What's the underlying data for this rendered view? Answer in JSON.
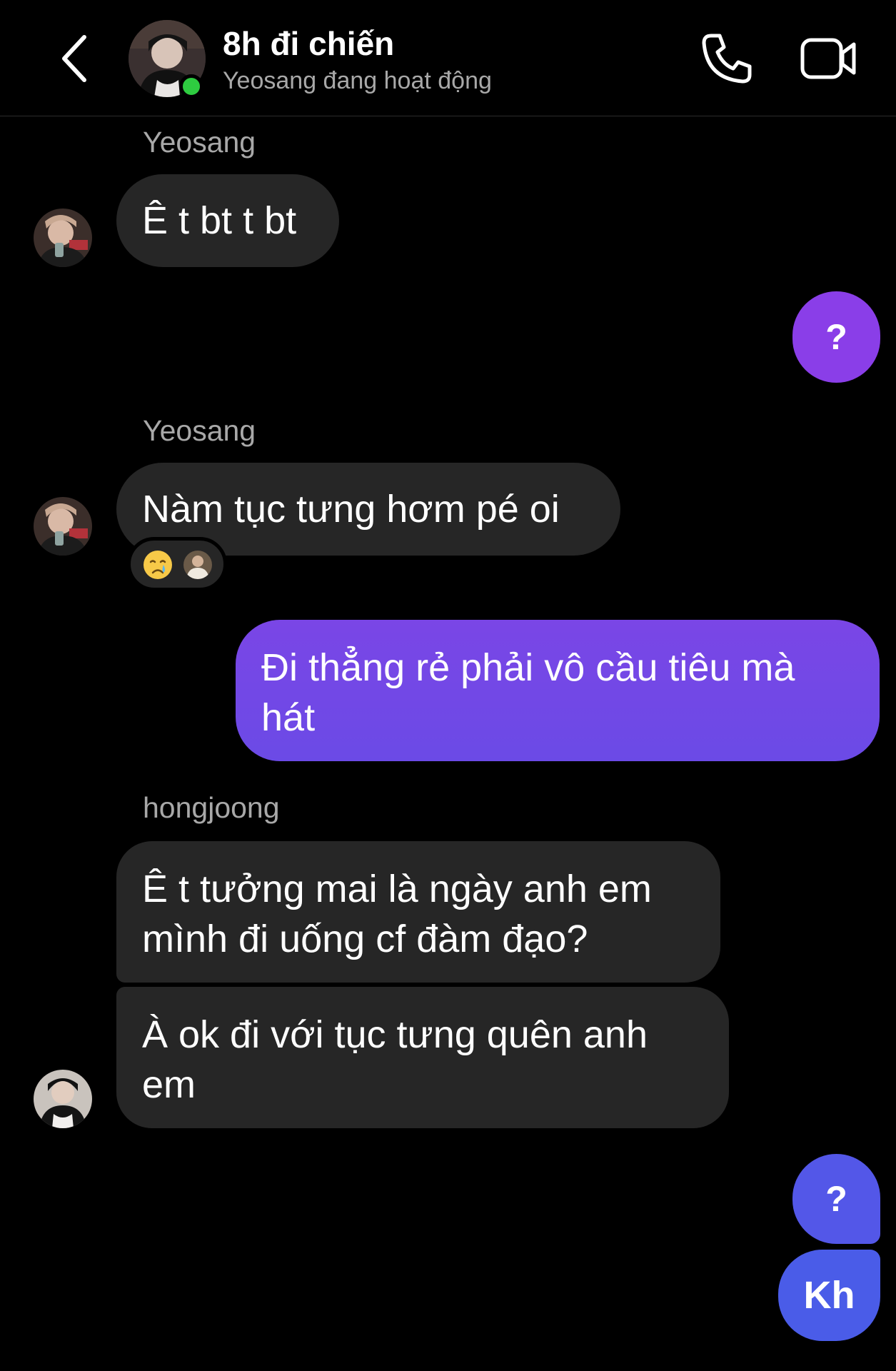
{
  "header": {
    "title": "8h đi chiến",
    "status": "Yeosang đang hoạt động",
    "icons": [
      "back-arrow-icon",
      "phone-icon",
      "video-camera-icon"
    ]
  },
  "colors": {
    "background": "#000000",
    "incoming_bubble": "#262626",
    "outgoing_gradient_top": "#8b3fe6",
    "outgoing_gradient_bottom": "#4a5be8",
    "secondary_text": "#a8a8a8",
    "online": "#2ecc40"
  },
  "messages": [
    {
      "direction": "in",
      "sender": "Yeosang",
      "text": "Ê t bt t bt"
    },
    {
      "direction": "out",
      "text": "?"
    },
    {
      "direction": "in",
      "sender": "Yeosang",
      "text": "Nàm tục tưng hơm pé oi",
      "reaction": "crying-face-emoji"
    },
    {
      "direction": "out",
      "lines": [
        "Đi thẳng rẻ phải vô cầu tiêu mà",
        "hát"
      ]
    },
    {
      "direction": "in",
      "sender": "hongjoong",
      "lines": [
        "Ê t tưởng mai là ngày anh em",
        "mình đi uống cf đàm đạo?"
      ]
    },
    {
      "direction": "in",
      "lines": [
        "À ok đi với tục tưng quên anh",
        "em"
      ]
    },
    {
      "direction": "out",
      "text": "?"
    },
    {
      "direction": "out",
      "text": "Kh"
    }
  ]
}
